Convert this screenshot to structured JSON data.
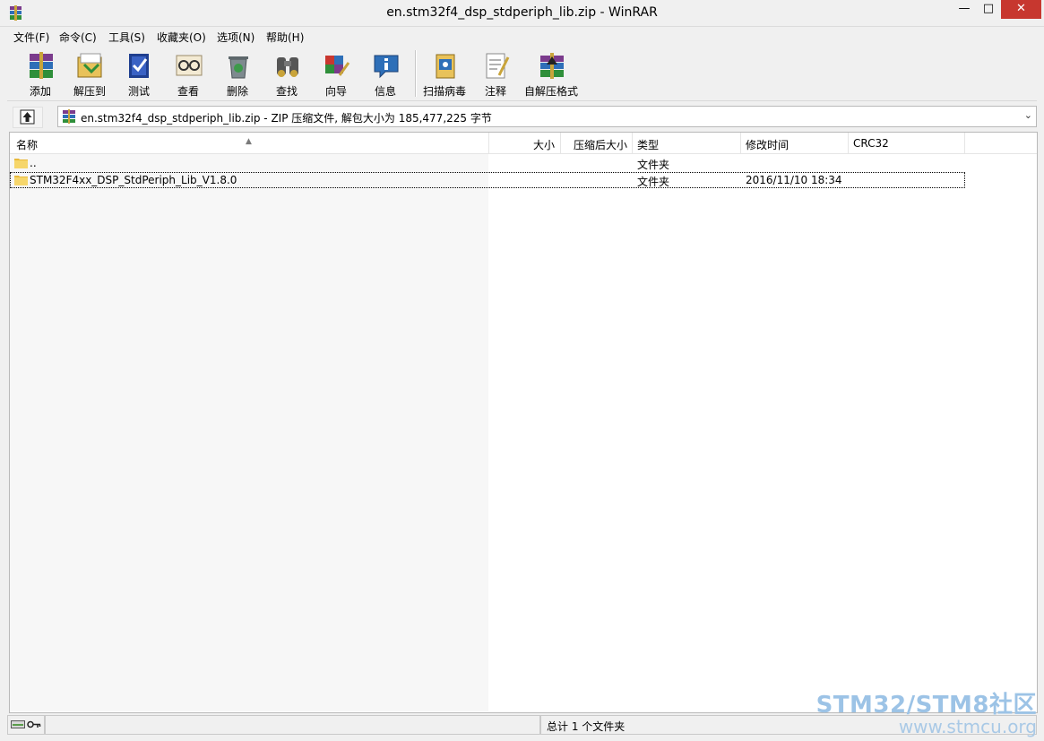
{
  "window": {
    "title": "en.stm32f4_dsp_stdperiph_lib.zip - WinRAR",
    "accent_color": "#5b9bd5",
    "close_color": "#c7372f"
  },
  "menu": {
    "items": [
      "文件(F)",
      "命令(C)",
      "工具(S)",
      "收藏夹(O)",
      "选项(N)",
      "帮助(H)"
    ]
  },
  "toolbar": {
    "buttons": [
      {
        "label": "添加",
        "icon": "add-archive-icon"
      },
      {
        "label": "解压到",
        "icon": "extract-to-icon"
      },
      {
        "label": "测试",
        "icon": "test-icon"
      },
      {
        "label": "查看",
        "icon": "view-icon"
      },
      {
        "label": "删除",
        "icon": "delete-icon"
      },
      {
        "label": "查找",
        "icon": "find-icon"
      },
      {
        "label": "向导",
        "icon": "wizard-icon"
      },
      {
        "label": "信息",
        "icon": "info-icon"
      },
      {
        "label": "扫描病毒",
        "icon": "virus-scan-icon"
      },
      {
        "label": "注释",
        "icon": "comment-icon"
      },
      {
        "label": "自解压格式",
        "icon": "sfx-icon"
      }
    ]
  },
  "address": {
    "path": "en.stm32f4_dsp_stdperiph_lib.zip - ZIP 压缩文件, 解包大小为 185,477,225 字节"
  },
  "file_list": {
    "columns": [
      "名称",
      "大小",
      "压缩后大小",
      "类型",
      "修改时间",
      "CRC32"
    ],
    "rows": [
      {
        "name": "..",
        "size": "",
        "packed": "",
        "type": "文件夹",
        "modified": "",
        "crc": ""
      },
      {
        "name": "STM32F4xx_DSP_StdPeriph_Lib_V1.8.0",
        "size": "",
        "packed": "",
        "type": "文件夹",
        "modified": "2016/11/10 18:34",
        "crc": ""
      }
    ]
  },
  "status": {
    "summary": "总计 1 个文件夹"
  },
  "watermark": {
    "line1": "STM32/STM8社区",
    "line2": "www.stmcu.org"
  }
}
